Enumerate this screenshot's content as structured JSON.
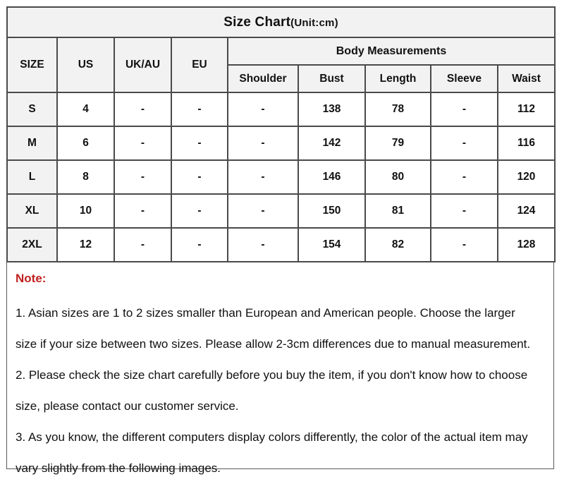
{
  "table": {
    "title": {
      "main": "Size Chart",
      "unit": "(Unit:cm)"
    },
    "group_header": "Body Measurements",
    "headers": {
      "size": "SIZE",
      "us": "US",
      "uk_au": "UK/AU",
      "eu": "EU",
      "shoulder": "Shoulder",
      "bust": "Bust",
      "length": "Length",
      "sleeve": "Sleeve",
      "waist": "Waist"
    },
    "rows": [
      {
        "size": "S",
        "us": "4",
        "uk_au": "-",
        "eu": "-",
        "shoulder": "-",
        "bust": "138",
        "length": "78",
        "sleeve": "-",
        "waist": "112"
      },
      {
        "size": "M",
        "us": "6",
        "uk_au": "-",
        "eu": "-",
        "shoulder": "-",
        "bust": "142",
        "length": "79",
        "sleeve": "-",
        "waist": "116"
      },
      {
        "size": "L",
        "us": "8",
        "uk_au": "-",
        "eu": "-",
        "shoulder": "-",
        "bust": "146",
        "length": "80",
        "sleeve": "-",
        "waist": "120"
      },
      {
        "size": "XL",
        "us": "10",
        "uk_au": "-",
        "eu": "-",
        "shoulder": "-",
        "bust": "150",
        "length": "81",
        "sleeve": "-",
        "waist": "124"
      },
      {
        "size": "2XL",
        "us": "12",
        "uk_au": "-",
        "eu": "-",
        "shoulder": "-",
        "bust": "154",
        "length": "82",
        "sleeve": "-",
        "waist": "128"
      }
    ]
  },
  "note": {
    "title": "Note:",
    "title_color": "#c0201f",
    "lines": [
      "1. Asian sizes are 1 to 2 sizes smaller than European and American people. Choose the larger",
      "size if your size between two sizes. Please allow 2-3cm differences due to manual measurement.",
      "2. Please check the size chart carefully before you buy the item, if you don't know how to choose",
      "size, please contact our customer service.",
      "3. As you know, the different computers display colors differently, the color of the actual item may",
      "vary slightly from the following images."
    ]
  }
}
